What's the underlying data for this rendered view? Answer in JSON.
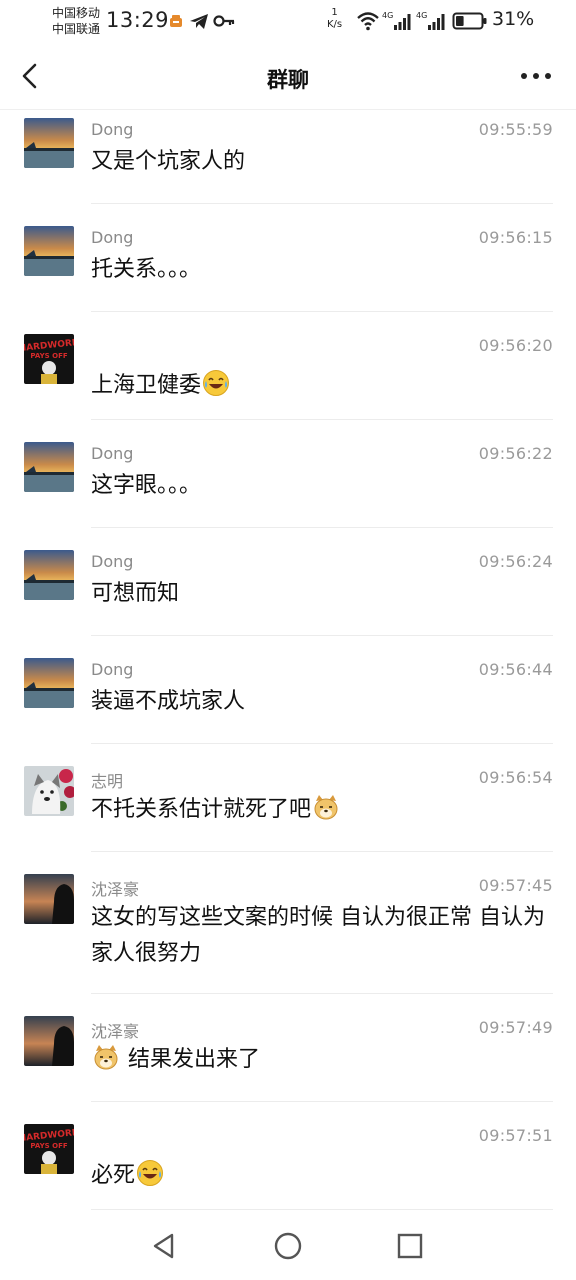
{
  "status_bar": {
    "carrier_1": "中国移动",
    "carrier_2": "中国联通",
    "time": "13:29",
    "net_speed_value": "1",
    "net_speed_unit": "K/s",
    "signal_1_label": "4G",
    "signal_2_label": "4G",
    "battery_percent": "31%",
    "battery_level": 0.31
  },
  "nav": {
    "title": "群聊"
  },
  "messages": [
    {
      "sender": "Dong",
      "time": "09:55:59",
      "text": "又是个坑家人的",
      "avatar": "sunset-landscape",
      "emoji": null
    },
    {
      "sender": "Dong",
      "time": "09:56:15",
      "text": "托关系。。。",
      "avatar": "sunset-landscape",
      "emoji": null
    },
    {
      "sender": "",
      "time": "09:56:20",
      "text": "上海卫健委",
      "avatar": "hardwork-poster",
      "emoji": "laugh-cry"
    },
    {
      "sender": "Dong",
      "time": "09:56:22",
      "text": "这字眼。。。",
      "avatar": "sunset-landscape",
      "emoji": null
    },
    {
      "sender": "Dong",
      "time": "09:56:24",
      "text": "可想而知",
      "avatar": "sunset-landscape",
      "emoji": null
    },
    {
      "sender": "Dong",
      "time": "09:56:44",
      "text": "装逼不成坑家人",
      "avatar": "sunset-landscape",
      "emoji": null
    },
    {
      "sender": "志明",
      "time": "09:56:54",
      "text": "不托关系估计就死了吧",
      "avatar": "husky-flowers",
      "emoji": "doge"
    },
    {
      "sender": "沈泽豪",
      "time": "09:57:45",
      "text": "这女的写这些文案的时候 自认为很正常 自认为家人很努力",
      "avatar": "silhouette-dusk",
      "emoji": null
    },
    {
      "sender": "沈泽豪",
      "time": "09:57:49",
      "text": " 结果发出来了",
      "avatar": "silhouette-dusk",
      "emoji_prefix": "doge"
    },
    {
      "sender": "",
      "time": "09:57:51",
      "text": "必死",
      "avatar": "hardwork-poster",
      "emoji": "laugh-cry"
    }
  ],
  "avatar_text": {
    "hardwork_line1": "HARDWORK",
    "hardwork_line2": "PAYS OFF"
  },
  "colors": {
    "background": "#ffffff",
    "sender_gray": "#8a8a8a",
    "time_gray": "#9a9a9a",
    "divider": "#ececec"
  }
}
